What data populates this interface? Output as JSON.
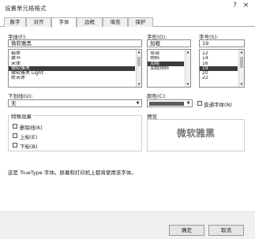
{
  "window": {
    "title": "设置单元格格式",
    "help_glyph": "?",
    "close_glyph": "×"
  },
  "tabs": [
    {
      "label": "数字"
    },
    {
      "label": "对齐"
    },
    {
      "label": "字体"
    },
    {
      "label": "边框"
    },
    {
      "label": "填充"
    },
    {
      "label": "保护"
    }
  ],
  "font": {
    "label": "字体(F):",
    "value": "微软雅黑",
    "items": [
      "楷体",
      "隶书",
      "宋体",
      "微软雅黑",
      "微软雅黑 Light",
      "新宋体"
    ],
    "selected_index": 3
  },
  "style": {
    "label": "字形(O):",
    "value": "加粗",
    "items": [
      "常规",
      "倾斜",
      "加粗",
      "加粗倾斜"
    ],
    "selected_index": 2
  },
  "size": {
    "label": "字号(S):",
    "value": "19",
    "items": [
      "12",
      "14",
      "16",
      "19",
      "20",
      "22"
    ],
    "selected_index": 3
  },
  "underline": {
    "label": "下划线(U):",
    "value": "无"
  },
  "color": {
    "label": "颜色(C):",
    "swatch_color": "#5a5a5a"
  },
  "normal_font": {
    "label": "普通字体(N)",
    "checked": false
  },
  "effects": {
    "label": "特殊效果",
    "strikethrough": {
      "label": "删除线(K)",
      "checked": false
    },
    "superscript": {
      "label": "上标(E)",
      "checked": false
    },
    "subscript": {
      "label": "下标(B)",
      "checked": false
    }
  },
  "preview": {
    "label": "预览",
    "sample_text": "微软雅黑"
  },
  "info_text": "这是 TrueType 字体。屏幕和打印机上都将使用该字体。",
  "buttons": {
    "ok": "确定",
    "cancel": "取消"
  },
  "colors": {
    "selection": "#3b3b3b",
    "swatch": "#5a5a5a"
  }
}
